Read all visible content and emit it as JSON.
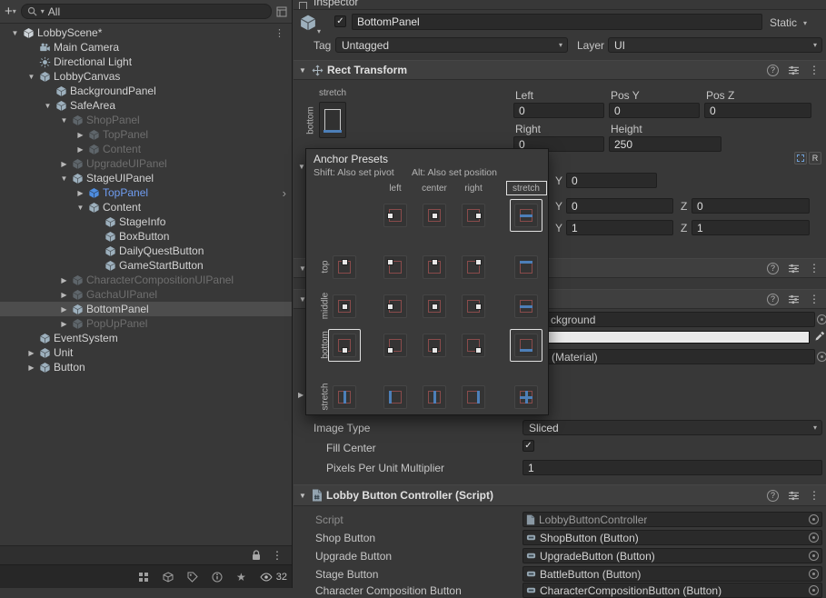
{
  "hierarchy": {
    "search_text": "All",
    "items": [
      {
        "label": "LobbyScene*",
        "depth": 0,
        "icon": "scene",
        "arrow": "expanded",
        "style": "normal",
        "trailing": "kebab"
      },
      {
        "label": "Main Camera",
        "depth": 1,
        "icon": "camera",
        "arrow": "none",
        "style": "normal"
      },
      {
        "label": "Directional Light",
        "depth": 1,
        "icon": "light",
        "arrow": "none",
        "style": "normal"
      },
      {
        "label": "LobbyCanvas",
        "depth": 1,
        "icon": "cube",
        "arrow": "expanded",
        "style": "normal"
      },
      {
        "label": "BackgroundPanel",
        "depth": 2,
        "icon": "cube",
        "arrow": "none",
        "style": "normal"
      },
      {
        "label": "SafeArea",
        "depth": 2,
        "icon": "cube",
        "arrow": "expanded",
        "style": "normal"
      },
      {
        "label": "ShopPanel",
        "depth": 3,
        "icon": "cube",
        "arrow": "expanded",
        "style": "muted"
      },
      {
        "label": "TopPanel",
        "depth": 4,
        "icon": "cube",
        "arrow": "collapsed",
        "style": "muted"
      },
      {
        "label": "Content",
        "depth": 4,
        "icon": "cube",
        "arrow": "collapsed",
        "style": "muted"
      },
      {
        "label": "UpgradeUIPanel",
        "depth": 3,
        "icon": "cube",
        "arrow": "collapsed",
        "style": "muted"
      },
      {
        "label": "StageUIPanel",
        "depth": 3,
        "icon": "cube",
        "arrow": "expanded",
        "style": "normal"
      },
      {
        "label": "TopPanel",
        "depth": 4,
        "icon": "prefab",
        "arrow": "collapsed",
        "style": "prefab",
        "trailing": "chevron"
      },
      {
        "label": "Content",
        "depth": 4,
        "icon": "cube",
        "arrow": "expanded",
        "style": "normal"
      },
      {
        "label": "StageInfo",
        "depth": 5,
        "icon": "cube",
        "arrow": "none",
        "style": "normal"
      },
      {
        "label": "BoxButton",
        "depth": 5,
        "icon": "cube",
        "arrow": "none",
        "style": "normal"
      },
      {
        "label": "DailyQuestButton",
        "depth": 5,
        "icon": "cube",
        "arrow": "none",
        "style": "normal"
      },
      {
        "label": "GameStartButton",
        "depth": 5,
        "icon": "cube",
        "arrow": "none",
        "style": "normal"
      },
      {
        "label": "CharacterCompositionUIPanel",
        "depth": 3,
        "icon": "cube",
        "arrow": "collapsed",
        "style": "muted"
      },
      {
        "label": "GachaUIPanel",
        "depth": 3,
        "icon": "cube",
        "arrow": "collapsed",
        "style": "muted"
      },
      {
        "label": "BottomPanel",
        "depth": 3,
        "icon": "cube",
        "arrow": "collapsed",
        "style": "normal",
        "selected": true
      },
      {
        "label": "PopUpPanel",
        "depth": 3,
        "icon": "cube",
        "arrow": "collapsed",
        "style": "muted"
      },
      {
        "label": "EventSystem",
        "depth": 1,
        "icon": "cube",
        "arrow": "none",
        "style": "normal"
      },
      {
        "label": "Unit",
        "depth": 1,
        "icon": "cube",
        "arrow": "collapsed",
        "style": "normal"
      },
      {
        "label": "Button",
        "depth": 1,
        "icon": "cube",
        "arrow": "collapsed",
        "style": "normal"
      }
    ],
    "status": {
      "visible_count": "32"
    }
  },
  "inspector": {
    "tab_title": "Inspector",
    "header": {
      "name": "BottomPanel",
      "static_label": "Static",
      "tag_label": "Tag",
      "tag_value": "Untagged",
      "layer_label": "Layer",
      "layer_value": "UI"
    },
    "rect_transform": {
      "title": "Rect Transform",
      "anchor_h_label": "stretch",
      "anchor_v_label": "bottom",
      "row1": [
        {
          "label": "Left",
          "value": "0"
        },
        {
          "label": "Pos Y",
          "value": "0"
        },
        {
          "label": "Pos Z",
          "value": "0"
        }
      ],
      "row2": [
        {
          "label": "Right",
          "value": "0"
        },
        {
          "label": "Height",
          "value": "250"
        }
      ],
      "raw_edit_label": "R",
      "partial_rows": [
        {
          "y_label": "Y",
          "y_value": "0"
        },
        {
          "y_label": "Y",
          "y_value": "0",
          "z_label": "Z",
          "z_value": "0"
        },
        {
          "y_label": "Y",
          "y_value": "1",
          "z_label": "Z",
          "z_value": "1"
        }
      ]
    },
    "anchor_popup": {
      "title": "Anchor Presets",
      "hint_shift": "Shift: Also set pivot",
      "hint_alt": "Alt: Also set position",
      "columns": [
        "left",
        "center",
        "right",
        "stretch"
      ],
      "rows": [
        "top",
        "middle",
        "bottom",
        "stretch"
      ],
      "selected": {
        "h": "stretch",
        "v": "bottom"
      }
    },
    "image_component": {
      "source_image_visible_text": "ckground",
      "material_visible_text": "(Material)",
      "image_type_label": "Image Type",
      "image_type_value": "Sliced",
      "fill_center_label": "Fill Center",
      "ppu_label": "Pixels Per Unit Multiplier",
      "ppu_value": "1"
    },
    "lobby_controller": {
      "title": "Lobby Button Controller (Script)",
      "rows": [
        {
          "label": "Script",
          "value": "LobbyButtonController"
        },
        {
          "label": "Shop Button",
          "value": "ShopButton (Button)"
        },
        {
          "label": "Upgrade Button",
          "value": "UpgradeButton (Button)"
        },
        {
          "label": "Stage Button",
          "value": "BattleButton (Button)"
        },
        {
          "label": "Character Composition Button",
          "value": "CharacterCompositionButton (Button)"
        }
      ]
    }
  }
}
